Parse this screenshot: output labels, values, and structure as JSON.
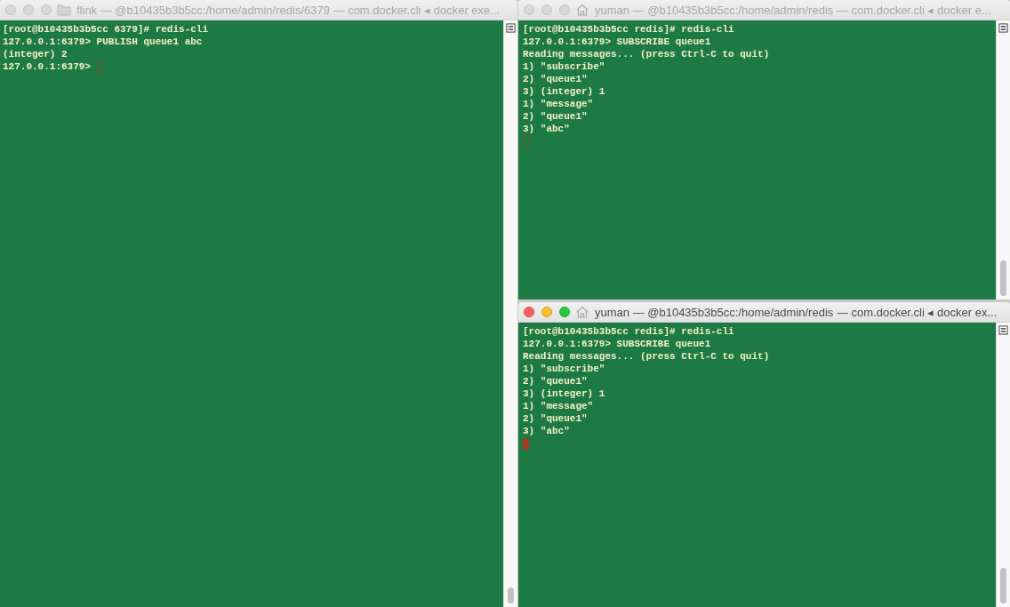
{
  "windows": [
    {
      "title": "flink — @b10435b3b5cc:/home/admin/redis/6379 — com.docker.cli ◂ docker exe...",
      "kind": "folder",
      "active": false,
      "lines": [
        "[root@b10435b3b5cc 6379]# redis-cli",
        "127.0.0.1:6379> PUBLISH queue1 abc",
        "(integer) 2"
      ],
      "prompt": "127.0.0.1:6379>"
    },
    {
      "title": "yuman — @b10435b3b5cc:/home/admin/redis — com.docker.cli ◂ docker e...",
      "kind": "home",
      "active": false,
      "lines": [
        "[root@b10435b3b5cc redis]# redis-cli",
        "127.0.0.1:6379> SUBSCRIBE queue1",
        "Reading messages... (press Ctrl-C to quit)",
        "1) \"subscribe\"",
        "2) \"queue1\"",
        "3) (integer) 1",
        "1) \"message\"",
        "2) \"queue1\"",
        "3) \"abc\""
      ]
    },
    {
      "title": "yuman — @b10435b3b5cc:/home/admin/redis — com.docker.cli ◂ docker ex...",
      "kind": "home",
      "active": true,
      "lines": [
        "[root@b10435b3b5cc redis]# redis-cli",
        "127.0.0.1:6379> SUBSCRIBE queue1",
        "Reading messages... (press Ctrl-C to quit)",
        "1) \"subscribe\"",
        "2) \"queue1\"",
        "3) (integer) 1",
        "1) \"message\"",
        "2) \"queue1\"",
        "3) \"abc\""
      ]
    }
  ]
}
